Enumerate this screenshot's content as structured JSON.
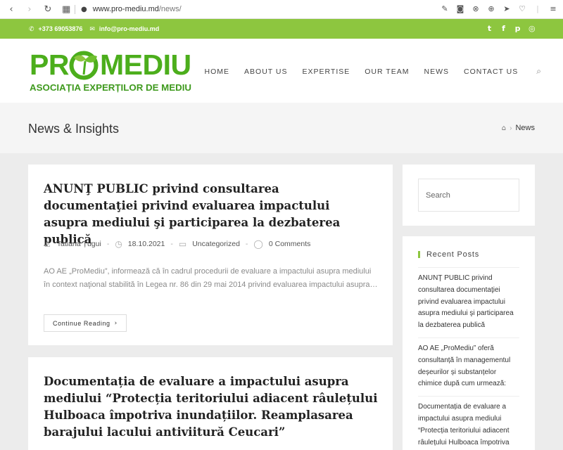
{
  "browser": {
    "url_host": "www.pro-mediu.md",
    "url_path": "/news/"
  },
  "topbar": {
    "phone": "+373 69053876",
    "email": "info@pro-mediu.md",
    "social_icons": [
      "twitter-icon",
      "facebook-icon",
      "pinterest-icon",
      "instagram-icon"
    ]
  },
  "logo": {
    "brand": "PRO MEDIU",
    "subtitle": "ASOCIAȚIA EXPERȚILOR DE MEDIU"
  },
  "menu": {
    "items": [
      "HOME",
      "ABOUT US",
      "EXPERTISE",
      "OUR TEAM",
      "NEWS",
      "CONTACT US"
    ]
  },
  "page_header": {
    "title": "News & Insights",
    "breadcrumb_current": "News"
  },
  "posts": [
    {
      "title": "ANUNŢ PUBLIC privind consultarea documentaţiei privind evaluarea impactului asupra mediului şi participarea la dezbaterea publică",
      "author": "Tatiana Țugui",
      "date": "18.10.2021",
      "category": "Uncategorized",
      "comments": "0 Comments",
      "excerpt": "AO AE „ProMediu”, informează că în cadrul procedurii de evaluare a impactului asupra mediului în context naţional stabilită în Legea nr. 86 din 29 mai 2014 privind evaluarea impactului asupra…",
      "read_more": "Continue Reading"
    },
    {
      "title": "Documentația de evaluare a impactului asupra mediului “Protecția teritoriului adiacent râulețului Hulboaca împotriva inundațiilor. Reamplasarea barajului lacului antiviitură Ceucari”"
    }
  ],
  "sidebar": {
    "search_placeholder": "Search",
    "recent_title": "Recent Posts",
    "recent_posts": [
      "ANUNŢ PUBLIC privind consultarea documentaţiei privind evaluarea impactului asupra mediului şi participarea la dezbaterea publică",
      "AO AE „ProMediu” oferă consultanță în managementul deșeurilor și substanțelor chimice după cum urmează:",
      "Documentația de evaluare a impactului asupra mediului “Protecția teritoriului adiacent râulețului Hulboaca împotriva inundațiilor. Reamplasarea"
    ]
  },
  "colors": {
    "accent_green": "#8dc63f",
    "logo_green": "#4cae1c"
  }
}
